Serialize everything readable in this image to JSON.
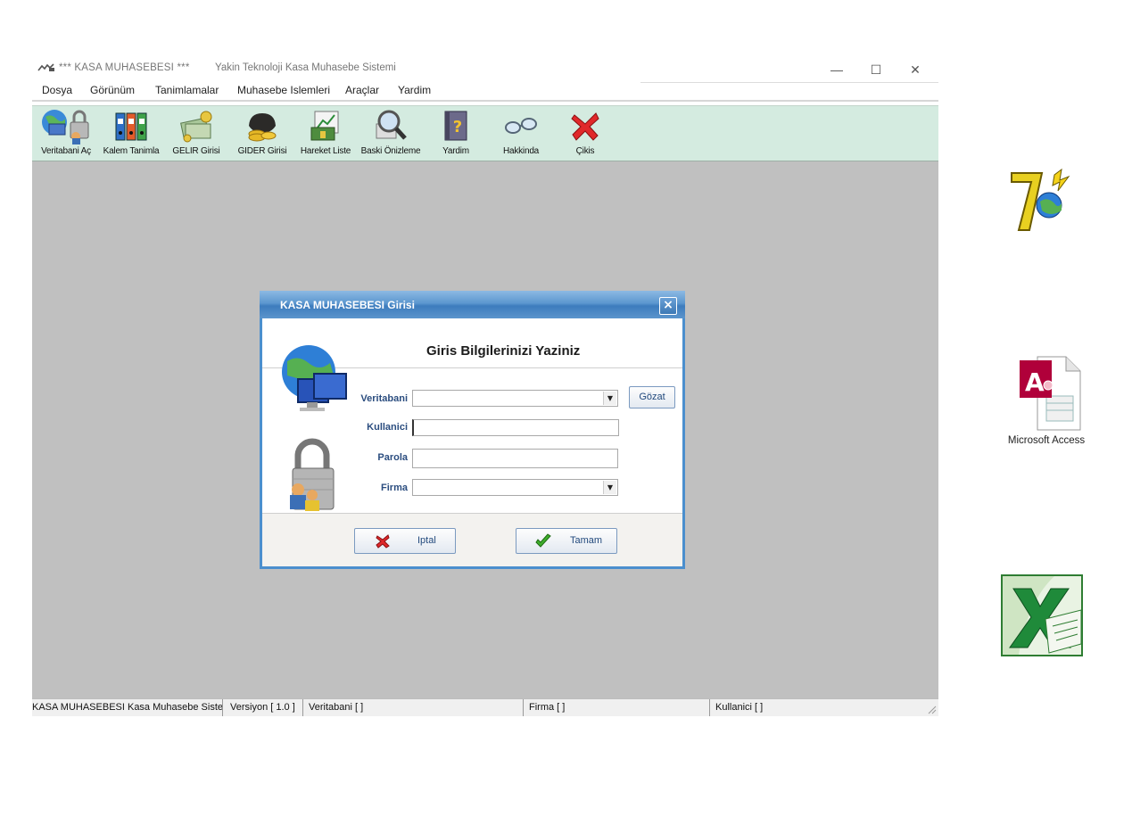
{
  "window": {
    "title_prefix": "***  KASA MUHASEBESI  ***",
    "subtitle": "Yakin Teknoloji Kasa Muhasebe Sistemi",
    "minimize": "—",
    "maximize": "☐",
    "close": "✕"
  },
  "menu": [
    "Dosya",
    "Görünüm",
    "Tanimlamalar",
    "Muhasebe Islemleri",
    "Araçlar",
    "Yardim"
  ],
  "toolbar": [
    {
      "label": "Veritabani Aç",
      "icon": "database-lock-icon"
    },
    {
      "label": "Kalem Tanimla",
      "icon": "binders-icon"
    },
    {
      "label": "GELIR Girisi",
      "icon": "money-icon"
    },
    {
      "label": "GIDER Girisi",
      "icon": "wallet-coins-icon"
    },
    {
      "label": "Hareket Liste",
      "icon": "chart-money-icon"
    },
    {
      "label": "Baski Önizleme",
      "icon": "magnifier-icon"
    },
    {
      "label": "Yardim",
      "icon": "help-book-icon"
    },
    {
      "label": "Hakkinda",
      "icon": "glasses-icon"
    },
    {
      "label": "Çikis",
      "icon": "red-x-icon"
    }
  ],
  "dialog": {
    "title": "KASA MUHASEBESI  Girisi",
    "heading": "Giris Bilgilerinizi Yaziniz",
    "database_label": "Veritabani",
    "database_value": "",
    "browse_button": "Gözat",
    "user_label": "Kullanici",
    "user_value": "",
    "password_label": "Parola",
    "password_value": "",
    "company_label": "Firma",
    "company_value": "",
    "cancel_button": "Iptal",
    "ok_button": "Tamam"
  },
  "statusbar": {
    "app": "KASA MUHASEBESI  Kasa Muhasebe Sistem",
    "version": "Versiyon [ 1.0 ]",
    "database": "Veritabani  [ ]",
    "company": "Firma  [ ]",
    "user": "Kullanici  [ ]"
  },
  "desktop": {
    "icon1": "",
    "icon2": "Microsoft Access",
    "icon3": ""
  },
  "colors": {
    "toolbar_bg": "#d4ebe0",
    "client_bg": "#c0c0c0",
    "dialog_border": "#4b8fce",
    "label_blue": "#2b4d7f"
  }
}
